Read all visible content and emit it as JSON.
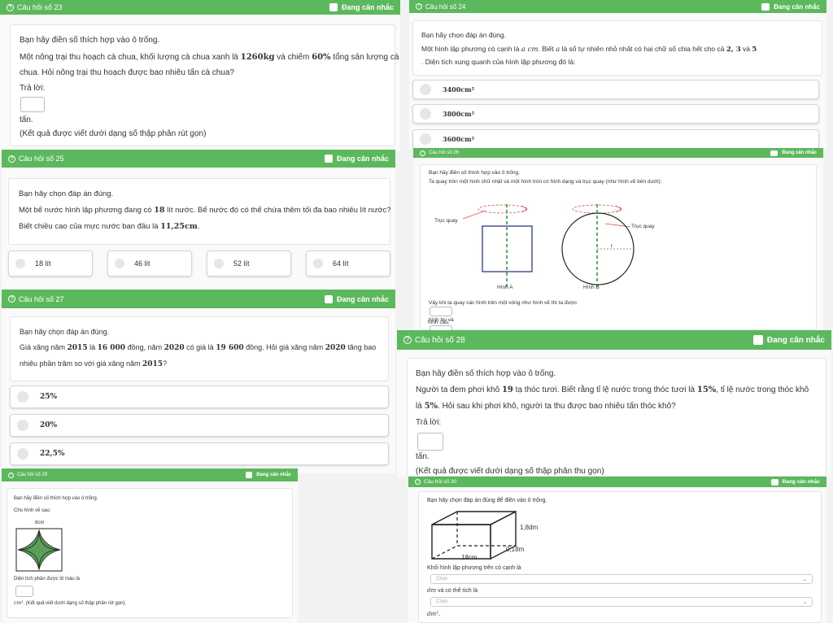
{
  "flag_label": "Đang cân nhắc",
  "fill_prompt": "Bạn hãy điền số thích hợp vào ô trống.",
  "choose_prompt": "Bạn hãy chọn đáp án đúng.",
  "answer_label": "Trả lời:",
  "q23": {
    "title": "Câu hỏi số 23",
    "line1a": "Một nông trại thu hoạch cà chua, khối lượng cà chua xanh là ",
    "line1b": "1260kg",
    "line1c": " và chiếm ",
    "line1d": "60%",
    "line1e": " tổng sản lượng cà",
    "line2": "chua. Hỏi nông trại thu hoạch được bao nhiêu tấn cà chua?",
    "unit": "tấn.",
    "note": "(Kết quả được viết dưới dạng số thập phân rút gọn)"
  },
  "q24": {
    "title": "Câu hỏi số 24",
    "line1a": "Một hình lập phương có cạnh là ",
    "line1b": "a cm",
    "line1c": ". Biết ",
    "line1d": "a",
    "line1e": " là số tự nhiên nhỏ nhất có hai chữ số chia hết cho cả ",
    "line1f": "2, 3",
    "line1g": " và ",
    "line1h": "5",
    "line2": ". Diện tích xung quanh của hình lập phương đó là:",
    "options": [
      "3400cm²",
      "3800cm²",
      "3600cm²"
    ]
  },
  "q25": {
    "title": "Câu hỏi số 25",
    "line1a": "Một bể nước hình lập phương đang có ",
    "line1b": "18",
    "line1c": " lít nước. Bể nước đó có thể chứa thêm tối đa bao nhiêu lít nước?",
    "line2a": "Biết chiều cao của mực nước ban đầu là ",
    "line2b": "11,25cm",
    "line2c": ".",
    "options": [
      "18 lít",
      "46 lít",
      "52 lít",
      "64 lít"
    ]
  },
  "q26": {
    "title": "Câu hỏi số 26",
    "line1": "Ta quay tròn một hình chữ nhật và một hình tròn có hình dạng và trục quay (như hình vẽ bên dưới):",
    "axis_label": "Trục quay",
    "fig_a": "Hình A",
    "fig_b": "Hình B",
    "radius": "r",
    "line2": "Vậy khi ta quay các hình trên một vòng như hình vẽ thì ta được",
    "after1": "hình trụ và",
    "after2": "hình cầu."
  },
  "q27": {
    "title": "Câu hỏi số 27",
    "line1a": "Giá xăng năm ",
    "line1b": "2015",
    "line1c": " là ",
    "line1d": "16 000",
    "line1e": " đồng, năm ",
    "line1f": "2020",
    "line1g": " có giá là ",
    "line1h": "19 600",
    "line1i": " đồng. Hỏi giá xăng năm ",
    "line1j": "2020",
    "line1k": " tăng bao",
    "line2a": "nhiêu phần trăm so với giá xăng năm ",
    "line2b": "2015",
    "line2c": "?",
    "options": [
      "25%",
      "20%",
      "22,5%"
    ]
  },
  "q28": {
    "title": "Câu hỏi số 28",
    "line1a": "Người ta đem phơi khô ",
    "line1b": "19",
    "line1c": " tạ thóc tươi. Biết rằng tỉ lệ nước trong thóc tươi là ",
    "line1d": "15%",
    "line1e": ", tỉ lệ nước trong thóc khô",
    "line2a": "là ",
    "line2b": "5%",
    "line2c": ". Hỏi sau khi phơi khô, người ta thu được bao nhiêu tấn thóc khô?",
    "unit": "tấn.",
    "note": "(Kết quả được viết dưới dạng số thập phân thu gọn)"
  },
  "q29": {
    "title": "Câu hỏi số 29",
    "line1": "Cho hình vẽ sau:",
    "dim": "8cm",
    "line2": "Diện tích phần được tô màu là",
    "unit": "cm²",
    "note": ". (Kết quả viết dưới dạng số thập phân rút gọn)."
  },
  "q30": {
    "title": "Câu hỏi số 30",
    "prompt": "Bạn hãy chọn đáp án đúng để điền vào ô trống.",
    "dim_h": "1,8dm",
    "dim_w": "0,18m",
    "dim_l": "18cm",
    "line1": "Khối hình lập phương trên có cạnh là",
    "select_placeholder": "Chọn",
    "unit1": "dm",
    "line2": " và có thể tích là",
    "unit2": "dm³."
  },
  "colors": {
    "header": "#5cb85c",
    "shape_fill": "#5a9e5a",
    "axis_dash": "#2e9e3a",
    "rotation": "#d9534f"
  }
}
